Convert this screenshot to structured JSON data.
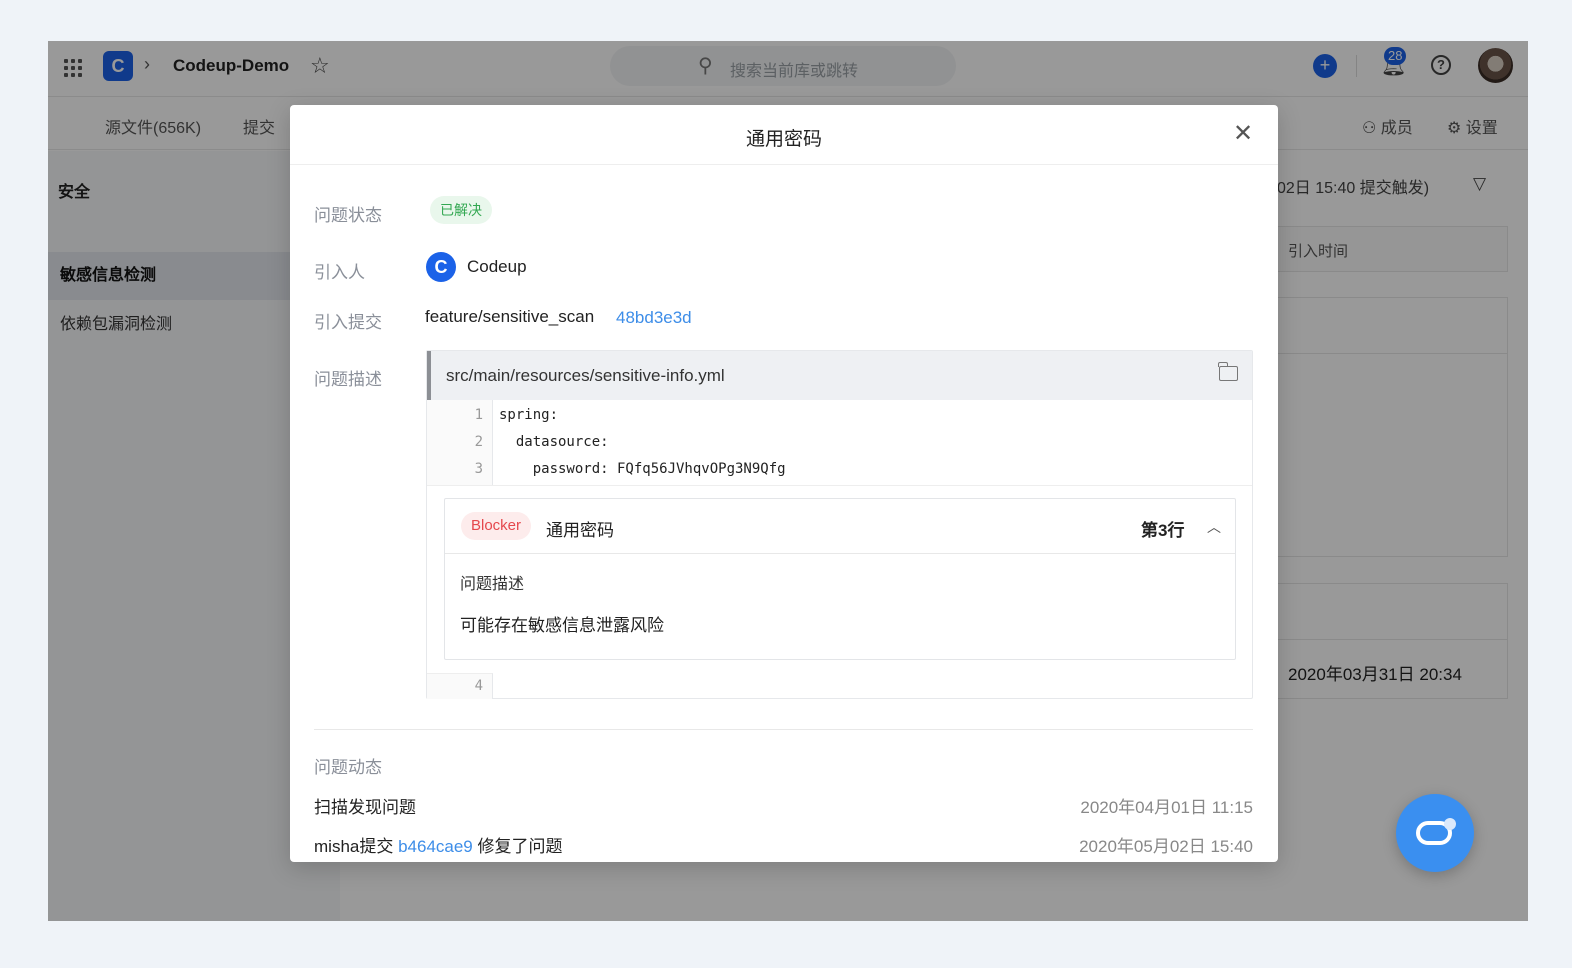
{
  "topbar": {
    "repo_name": "Codeup-Demo",
    "search_placeholder": "搜索当前库或跳转",
    "notification_count": "28"
  },
  "tabbar": {
    "tabs": [
      {
        "label": "源文件(656K)"
      },
      {
        "label": "提交"
      }
    ],
    "members_label": "成员",
    "settings_label": "设置"
  },
  "sidebar": {
    "title": "安全",
    "items": [
      {
        "label": "敏感信息检测",
        "active": true
      },
      {
        "label": "依赖包漏洞检测",
        "active": false
      }
    ]
  },
  "background": {
    "trigger_info": "02日 15:40 提交触发)",
    "column_header": "引入时间",
    "row_date": "2020年03月31日 20:34"
  },
  "modal": {
    "title": "通用密码",
    "labels": {
      "status": "问题状态",
      "introducer": "引入人",
      "commit": "引入提交",
      "description": "问题描述",
      "activity": "问题动态"
    },
    "status_value": "已解决",
    "introducer_name": "Codeup",
    "branch": "feature/sensitive_scan",
    "commit_hash": "48bd3e3d",
    "file_path": "src/main/resources/sensitive-info.yml",
    "code_lines": [
      {
        "num": "1",
        "text": "spring:"
      },
      {
        "num": "2",
        "text": "  datasource:"
      },
      {
        "num": "3",
        "text": "    password: FQfq56JVhqvOPg3N9Qfg"
      }
    ],
    "trailing_line_num": "4",
    "issue": {
      "severity": "Blocker",
      "rule": "通用密码",
      "line": "第3行",
      "desc_label": "问题描述",
      "desc_text": "可能存在敏感信息泄露风险"
    },
    "activities": [
      {
        "prefix": "扫描发现问题",
        "link": "",
        "suffix": "",
        "time": "2020年04月01日 11:15"
      },
      {
        "prefix": "misha提交 ",
        "link": "b464cae9",
        "suffix": " 修复了问题",
        "time": "2020年05月02日 15:40"
      }
    ]
  },
  "colors": {
    "accent": "#1b62e8",
    "link": "#3d8de8",
    "resolved": "#33a852",
    "blocker": "#e5484d"
  }
}
